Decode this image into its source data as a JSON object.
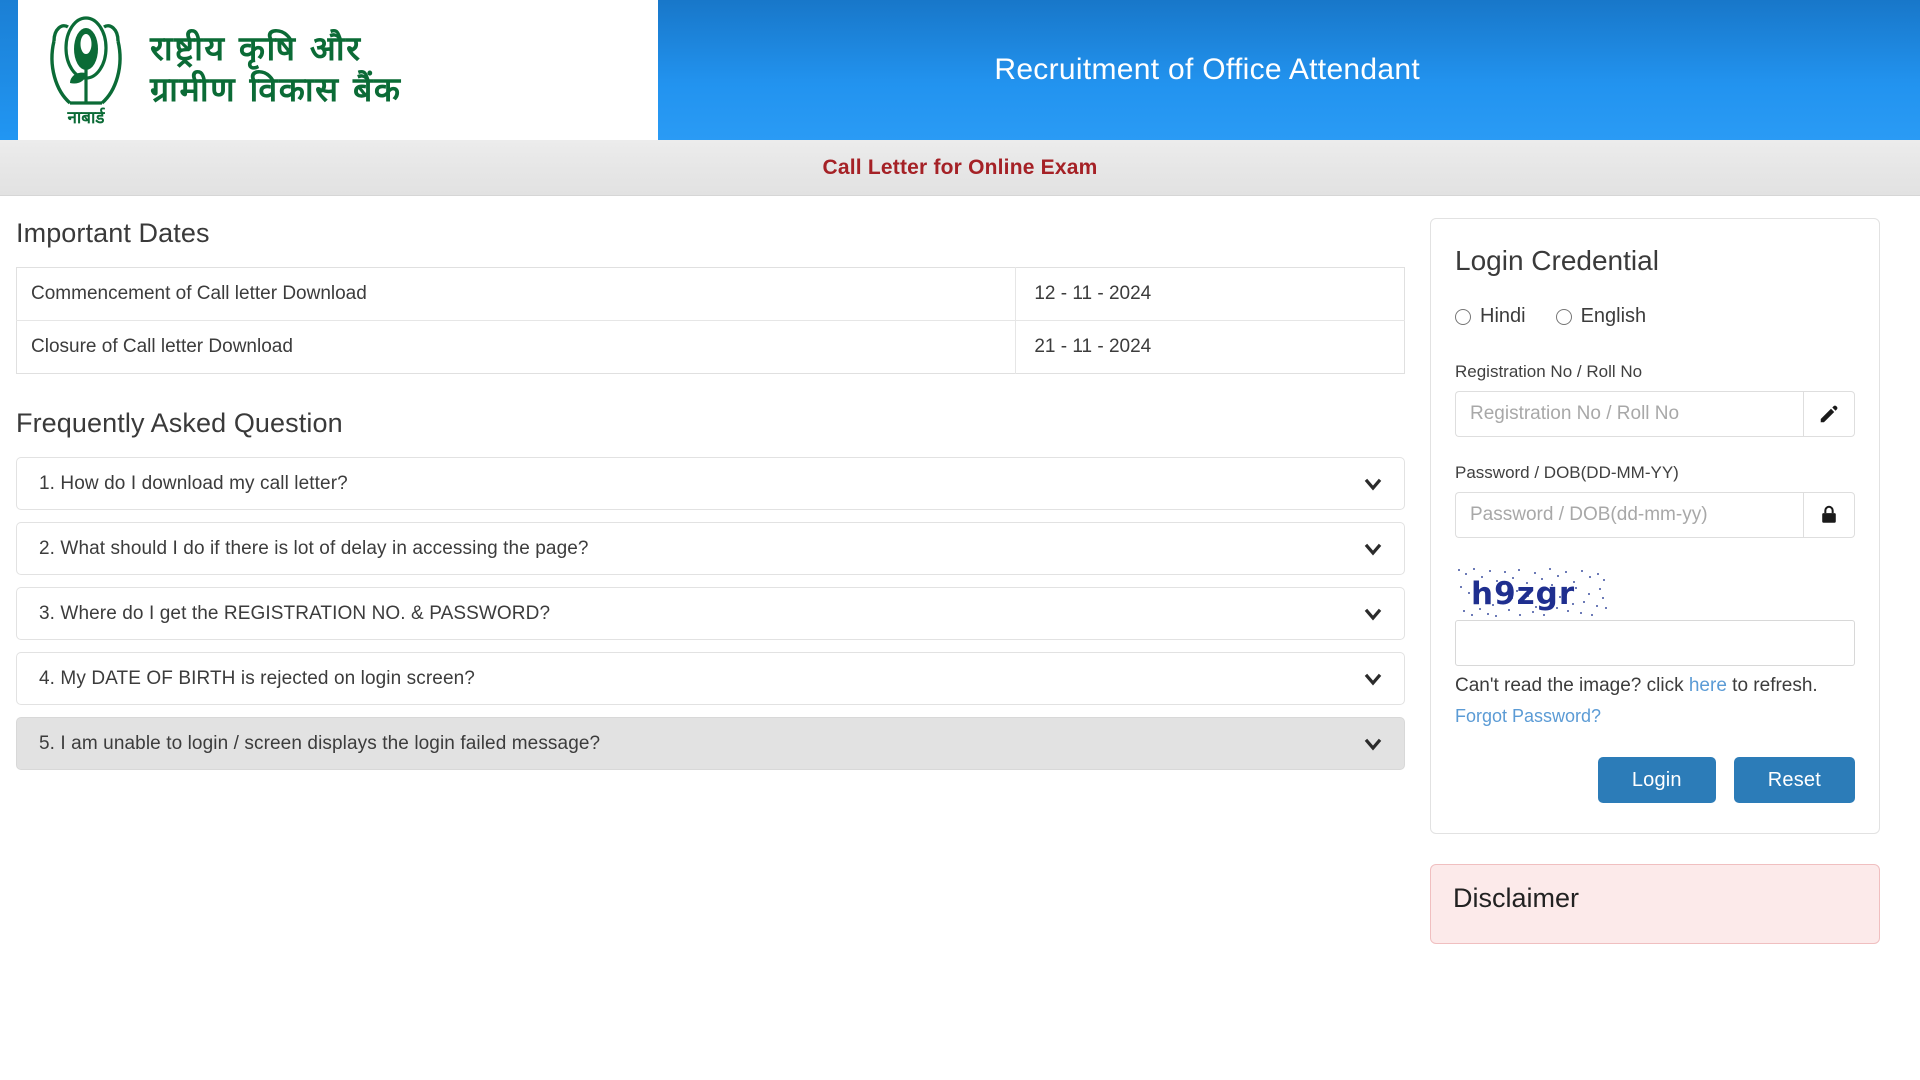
{
  "header": {
    "logo_lines": [
      "राष्ट्रीय कृषि और",
      "ग्रामीण विकास बैंक"
    ],
    "logo_caption": "नाबार्ड",
    "title": "Recruitment of Office Attendant",
    "banner_title": "Call Letter for Online Exam",
    "accent_blue": "#2293ef",
    "banner_red": "#a52126",
    "logo_green": "#0b6b36"
  },
  "important_dates": {
    "section_title": "Important Dates",
    "rows": [
      {
        "label": "Commencement of Call letter Download",
        "value": "12 - 11 - 2024"
      },
      {
        "label": "Closure of Call letter Download",
        "value": "21 - 11 - 2024"
      }
    ]
  },
  "faq": {
    "section_title": "Frequently Asked Question",
    "items": [
      {
        "question": "1. How do I download my call letter?",
        "active": false
      },
      {
        "question": "2. What should I do if there is lot of delay in accessing the page?",
        "active": false
      },
      {
        "question": "3. Where do I get the REGISTRATION NO. & PASSWORD?",
        "active": false
      },
      {
        "question": "4. My DATE OF BIRTH is rejected on login screen?",
        "active": false
      },
      {
        "question": "5. I am unable to login / screen displays the login failed message?",
        "active": true
      }
    ],
    "chevron_icon": "chevron-down-icon"
  },
  "login": {
    "heading": "Login Credential",
    "language_options": [
      {
        "label": "Hindi",
        "selected": false
      },
      {
        "label": "English",
        "selected": false
      }
    ],
    "registration": {
      "label": "Registration No / Roll No",
      "placeholder": "Registration No / Roll No",
      "value": "",
      "icon": "pencil-icon"
    },
    "password": {
      "label": "Password / DOB(DD-MM-YY)",
      "placeholder": "Password / DOB(dd-mm-yy)",
      "value": "",
      "icon": "lock-icon"
    },
    "captcha": {
      "text": "h9zgr",
      "value": "",
      "placeholder": "",
      "refresh_prefix": "Can't read the image? click ",
      "refresh_link": "here",
      "refresh_suffix": " to refresh.",
      "captcha_color": "#1f2f8f"
    },
    "forgot_password": "Forgot Password?",
    "login_button": "Login",
    "reset_button": "Reset",
    "button_color": "#2c7cb8",
    "link_color": "#5b9bd5"
  },
  "disclaimer": {
    "title": "Disclaimer",
    "border_color": "#f0bfc0",
    "background_color": "#fceaea"
  }
}
